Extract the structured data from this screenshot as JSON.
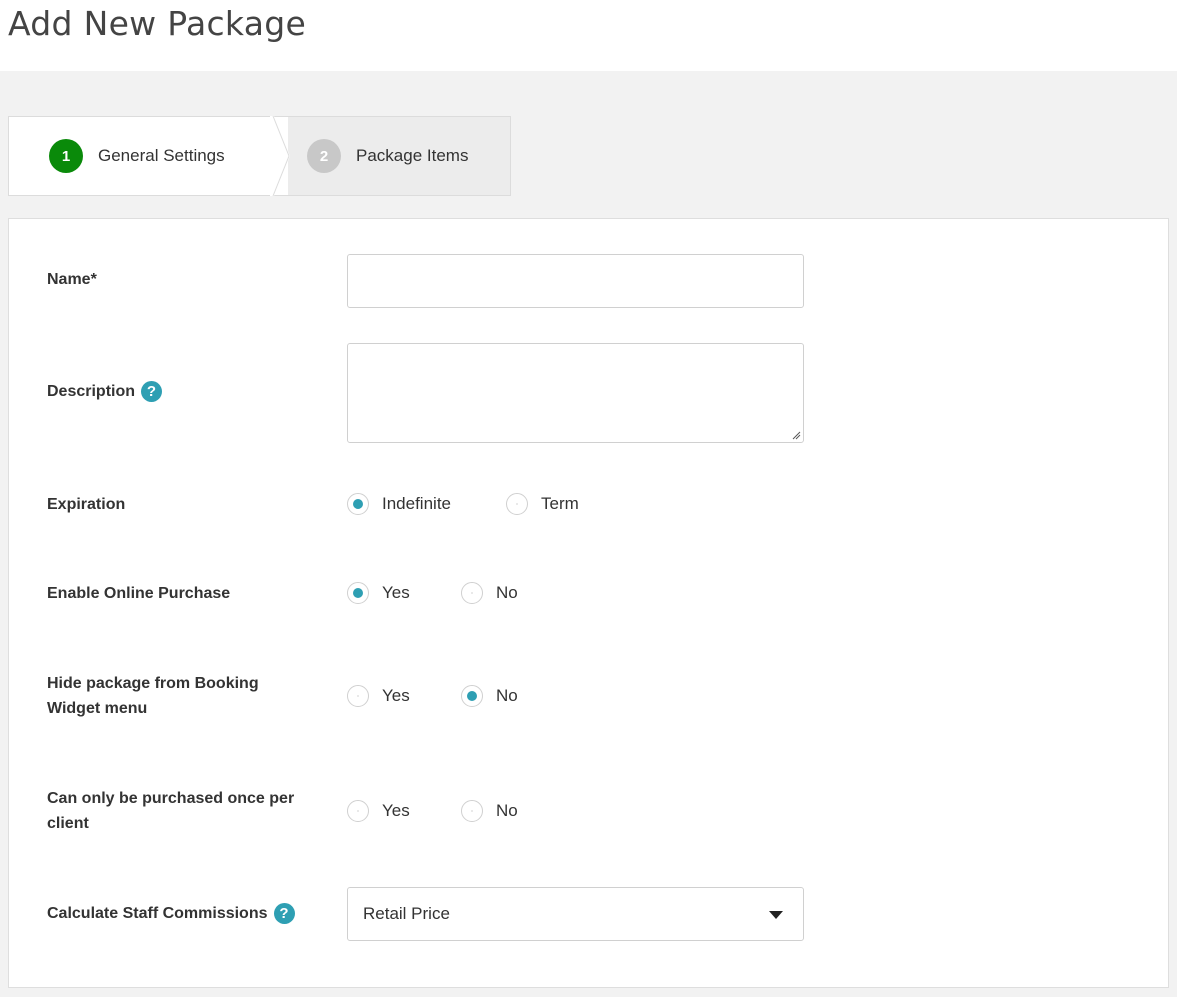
{
  "page": {
    "title": "Add New Package"
  },
  "wizard": {
    "steps": [
      {
        "number": "1",
        "label": "General Settings",
        "state": "active"
      },
      {
        "number": "2",
        "label": "Package Items",
        "state": "inactive"
      }
    ]
  },
  "form": {
    "name": {
      "label": "Name*",
      "value": "",
      "placeholder": ""
    },
    "description": {
      "label": "Description",
      "value": "",
      "placeholder": "",
      "help_icon": "question-mark-icon"
    },
    "expiration": {
      "label": "Expiration",
      "options": [
        {
          "label": "Indefinite",
          "checked": true
        },
        {
          "label": "Term",
          "checked": false
        }
      ]
    },
    "enable_online_purchase": {
      "label": "Enable Online Purchase",
      "options": [
        {
          "label": "Yes",
          "checked": true
        },
        {
          "label": "No",
          "checked": false
        }
      ]
    },
    "hide_from_booking_widget": {
      "label_line1": "Hide package from Booking",
      "label_line2": "Widget menu",
      "options": [
        {
          "label": "Yes",
          "checked": false
        },
        {
          "label": "No",
          "checked": true
        }
      ]
    },
    "purchase_once_per_client": {
      "label_line1": "Can only be purchased once per",
      "label_line2": "client",
      "options": [
        {
          "label": "Yes",
          "checked": false
        },
        {
          "label": "No",
          "checked": false
        }
      ]
    },
    "staff_commissions": {
      "label": "Calculate Staff Commissions",
      "help_icon": "question-mark-icon",
      "selected": "Retail Price"
    }
  },
  "colors": {
    "active_step": "#0a8a0a",
    "inactive_step": "#c8c8c8",
    "accent": "#2e9fb3",
    "background": "#f2f2f2"
  }
}
